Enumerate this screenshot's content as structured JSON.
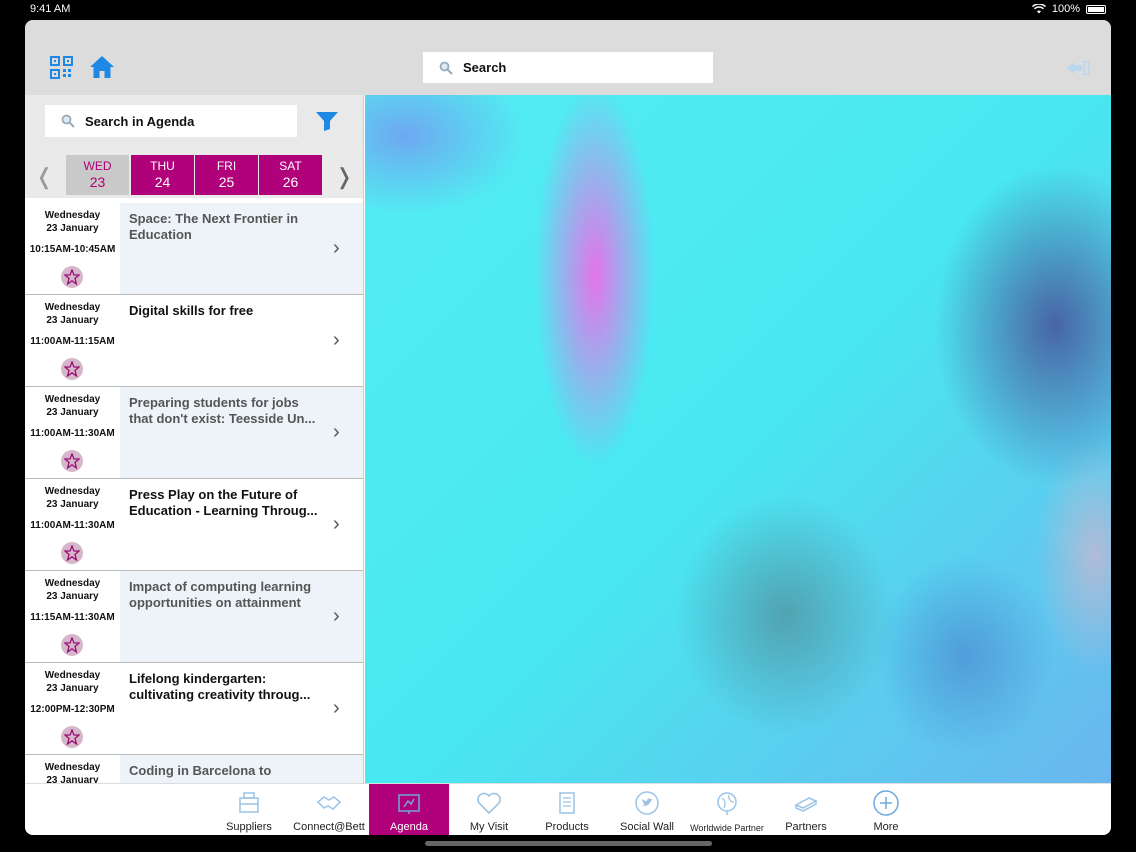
{
  "status": {
    "time": "9:41 AM",
    "battery": "100%"
  },
  "topbar": {
    "search_placeholder": "Search"
  },
  "agenda": {
    "search_placeholder": "Search in Agenda",
    "days": [
      {
        "name": "WED",
        "date": "23",
        "active": true
      },
      {
        "name": "THU",
        "date": "24",
        "active": false
      },
      {
        "name": "FRI",
        "date": "25",
        "active": false
      },
      {
        "name": "SAT",
        "date": "26",
        "active": false
      }
    ],
    "sessions": [
      {
        "day": "Wednesday",
        "date": "23 January",
        "time": "10:15AM-10:45AM",
        "title": "Space: The Next Frontier in Education"
      },
      {
        "day": "Wednesday",
        "date": "23 January",
        "time": "11:00AM-11:15AM",
        "title": "Digital skills for free"
      },
      {
        "day": "Wednesday",
        "date": "23 January",
        "time": "11:00AM-11:30AM",
        "title": "Preparing students for jobs that don't exist: Teesside Un..."
      },
      {
        "day": "Wednesday",
        "date": "23 January",
        "time": "11:00AM-11:30AM",
        "title": "Press Play on the Future of Education - Learning Throug..."
      },
      {
        "day": "Wednesday",
        "date": "23 January",
        "time": "11:15AM-11:30AM",
        "title": "Impact of computing learning opportunities on attainment"
      },
      {
        "day": "Wednesday",
        "date": "23 January",
        "time": "12:00PM-12:30PM",
        "title": "Lifelong kindergarten: cultivating creativity throug..."
      },
      {
        "day": "Wednesday",
        "date": "23 January",
        "time": "",
        "title": "Coding in Barcelona to"
      }
    ]
  },
  "tabs": [
    {
      "label": "Suppliers",
      "icon": "suppliers-icon"
    },
    {
      "label": "Connect@Bett",
      "icon": "handshake-icon"
    },
    {
      "label": "Agenda",
      "icon": "agenda-icon",
      "active": true
    },
    {
      "label": "My Visit",
      "icon": "heart-icon"
    },
    {
      "label": "Products",
      "icon": "products-icon"
    },
    {
      "label": "Social Wall",
      "icon": "twitter-icon"
    },
    {
      "label": "Worldwide Partner",
      "icon": "globe-icon"
    },
    {
      "label": "Partners",
      "icon": "partners-icon"
    },
    {
      "label": "More",
      "icon": "plus-circle-icon"
    }
  ],
  "colors": {
    "accent": "#b0007a",
    "icon_blue": "#1e88e5"
  }
}
